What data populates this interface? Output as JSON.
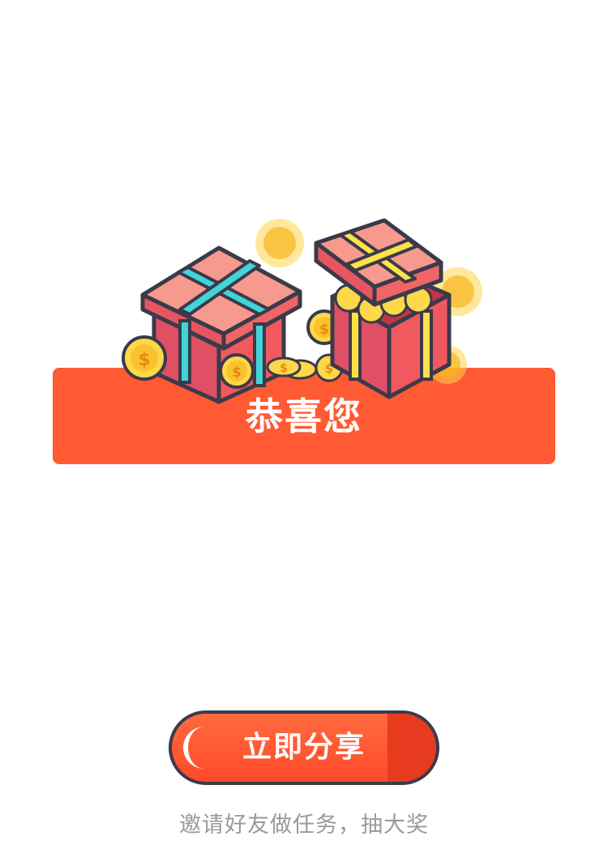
{
  "banner": {
    "title": "恭喜您"
  },
  "share_button": {
    "label": "立即分享"
  },
  "invite": {
    "text": "邀请好友做任务，抽大奖"
  },
  "colors": {
    "banner": "#ff5a33",
    "button": "#ff5a33",
    "button_border": "#3b3a4a",
    "caption": "#9a9a9a"
  },
  "icons": [
    "gift-box-icon",
    "open-gift-box-icon",
    "gold-coin-icon"
  ]
}
